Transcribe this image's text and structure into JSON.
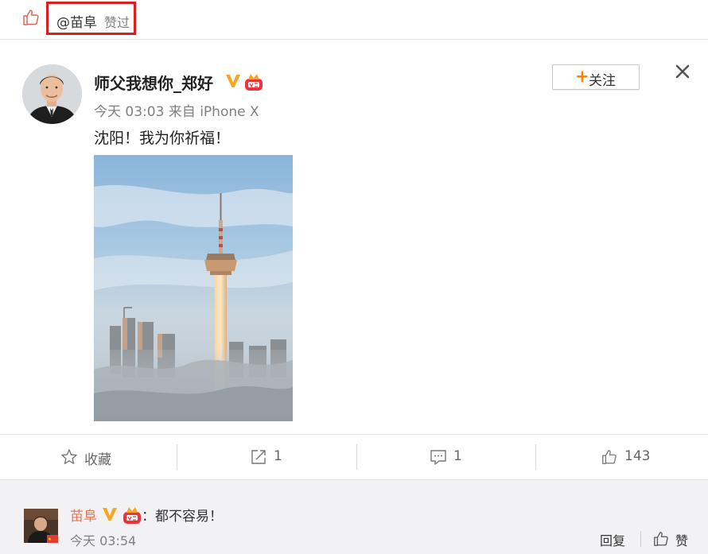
{
  "like_bar": {
    "user": "@苗阜",
    "suffix": "赞过"
  },
  "post": {
    "author": "师父我想你_郑好",
    "meta": "今天 03:03 来自 iPhone X",
    "follow_label": "关注",
    "follow_plus": "+",
    "text": "沈阳！我为你祈福！",
    "image_subject": "tv-tower-photo"
  },
  "actions": {
    "favorite_label": "收藏",
    "repost_count": "1",
    "comment_count": "1",
    "like_count": "143"
  },
  "comment": {
    "author": "苗阜",
    "text": "：都不容易！",
    "time": "今天 03:54",
    "reply_label": "回复",
    "like_label": "赞"
  },
  "colors": {
    "verified_badge": "#f6a623",
    "follow_plus": "#ff8200",
    "comment_author": "#eb7350",
    "highlight_box": "#d81e1e",
    "crown_red": "#e8353b"
  }
}
